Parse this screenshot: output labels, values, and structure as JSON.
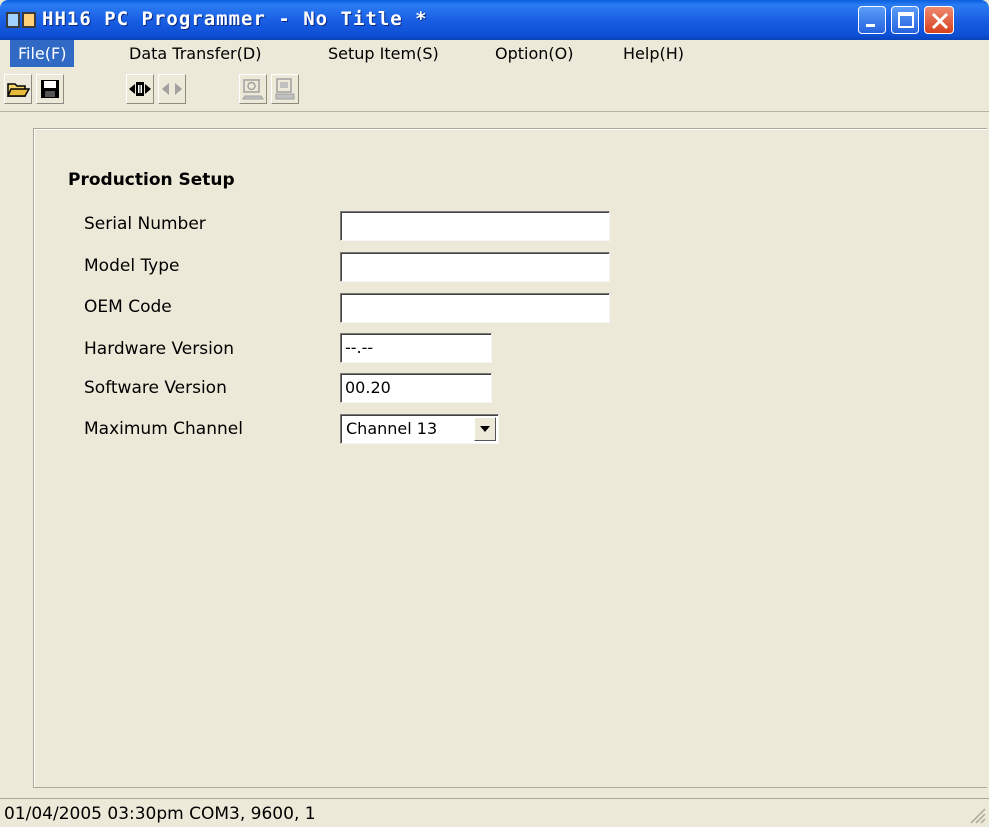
{
  "window": {
    "title": "HH16 PC Programmer - No Title *"
  },
  "menu": [
    {
      "label": "File(F)",
      "active": true
    },
    {
      "label": "Data Transfer(D)",
      "active": false
    },
    {
      "label": "Setup Item(S)",
      "active": false
    },
    {
      "label": "Option(O)",
      "active": false
    },
    {
      "label": "Help(H)",
      "active": false
    }
  ],
  "toolbar": {
    "buttons": [
      "open-folder-icon",
      "save-disk-icon",
      "connect-icon",
      "disconnect-icon",
      "read-device-icon",
      "write-device-icon"
    ]
  },
  "form": {
    "section_title": "Production Setup",
    "serial_number": {
      "label": "Serial Number",
      "value": ""
    },
    "model_type": {
      "label": "Model Type",
      "value": ""
    },
    "oem_code": {
      "label": "OEM Code",
      "value": ""
    },
    "hardware_version": {
      "label": "Hardware Version",
      "value": "--.--"
    },
    "software_version": {
      "label": "Software Version",
      "value": "00.20"
    },
    "maximum_channel": {
      "label": "Maximum Channel",
      "value": "Channel 13"
    }
  },
  "statusbar": {
    "text": "01/04/2005 03:30pm COM3, 9600, 1"
  },
  "colors": {
    "titlebar": "#0d4fd6",
    "menu_highlight": "#316ac5",
    "face": "#ece9d8",
    "close_button": "#d5401e"
  }
}
